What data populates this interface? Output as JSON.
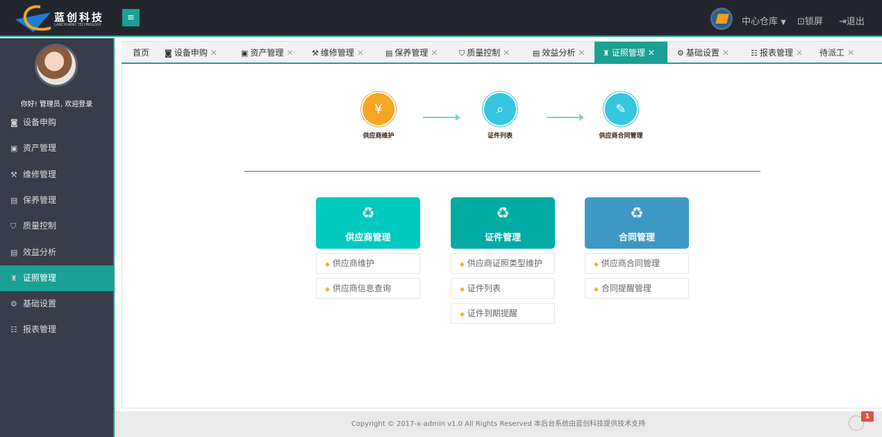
{
  "header": {
    "logo_text": "蓝创科技",
    "logo_sub": "LANCHUANG TECHNOLOGY",
    "menu_icon": "hamburger-icon",
    "warehouse": "中心仓库",
    "lock": "锁屏",
    "logout": "退出"
  },
  "sidebar": {
    "welcome": "你好! 管理员, 欢迎登录",
    "items": [
      {
        "label": "设备申购",
        "icon": "monitor-icon"
      },
      {
        "label": "资产管理",
        "icon": "box-icon"
      },
      {
        "label": "维修管理",
        "icon": "tools-icon"
      },
      {
        "label": "保养管理",
        "icon": "maintenance-icon"
      },
      {
        "label": "质量控制",
        "icon": "shield-icon"
      },
      {
        "label": "效益分析",
        "icon": "document-icon"
      },
      {
        "label": "证照管理",
        "icon": "badge-icon",
        "active": true
      },
      {
        "label": "基础设置",
        "icon": "gear-icon"
      },
      {
        "label": "报表管理",
        "icon": "list-icon"
      }
    ]
  },
  "tabs": [
    {
      "label": "首页"
    },
    {
      "label": "设备申购"
    },
    {
      "label": "资产管理"
    },
    {
      "label": "维修管理"
    },
    {
      "label": "保养管理"
    },
    {
      "label": "质量控制"
    },
    {
      "label": "效益分析"
    },
    {
      "label": "证照管理",
      "active": true
    },
    {
      "label": "基础设置"
    },
    {
      "label": "报表管理"
    },
    {
      "label": "待派工"
    }
  ],
  "flow": [
    {
      "label": "供应商维护",
      "color": "#f6a623"
    },
    {
      "label": "证件列表",
      "color": "#36c6e0"
    },
    {
      "label": "供应商合同管理",
      "color": "#36c6e0"
    }
  ],
  "cards": [
    {
      "title": "供应商管理",
      "color": "#00c9c0",
      "items": [
        "供应商维护",
        "供应商信息查询"
      ]
    },
    {
      "title": "证件管理",
      "color": "#00aba3",
      "items": [
        "供应商证照类型维护",
        "证件列表",
        "证件到期提醒"
      ]
    },
    {
      "title": "合同管理",
      "color": "#3e98c5",
      "items": [
        "供应商合同管理",
        "合同提醒管理"
      ]
    }
  ],
  "footer": {
    "copyright": "Copyright © 2017-x-admin v1.0 All Rights Reserved 本后台系统由蓝创科技提供技术支持",
    "badge": "1"
  }
}
